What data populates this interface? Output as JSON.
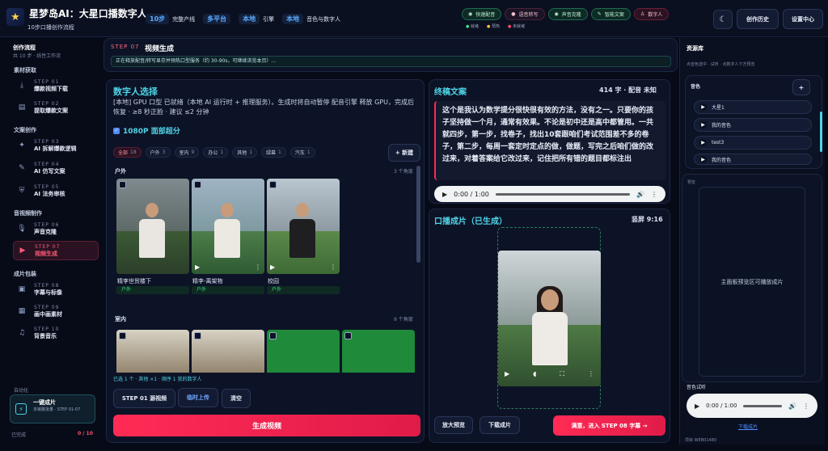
{
  "header": {
    "app_title": "星梦岛AI：大星口播数字人",
    "subtitle": "10步口播创作流程",
    "badges": [
      {
        "tag": "10步",
        "text": "完整产线"
      },
      {
        "tag": "多平台",
        "text": ""
      },
      {
        "tag": "本地",
        "text": "引擎"
      },
      {
        "tag": "本地",
        "text": "音色与数字人"
      }
    ],
    "services": [
      {
        "label": "快速配音",
        "color": "#3ddc84"
      },
      {
        "label": "语音转写",
        "color": "#ff4d6d"
      },
      {
        "label": "声音克隆",
        "color": "#3ddc84"
      },
      {
        "label": "智能文案",
        "color": "#3ddc84"
      },
      {
        "label": "数字人",
        "color": "#ff4d6d"
      }
    ],
    "legend": [
      {
        "label": "就绪",
        "color": "#3ddc84"
      },
      {
        "label": "预热",
        "color": "#ffb84d"
      },
      {
        "label": "未就绪",
        "color": "#ff4d6d"
      }
    ],
    "theme_icon": "moon-icon",
    "history_button": "创作历史",
    "settings_button": "设置中心"
  },
  "sidebar": {
    "title": "创作流程",
    "subtitle": "共 10 步 · 线性工作流",
    "groups": [
      {
        "label": "素材获取",
        "items": [
          {
            "step": "STEP 01",
            "name": "爆款视频下载",
            "icon": "download-icon"
          },
          {
            "step": "STEP 02",
            "name": "提取爆款文案",
            "icon": "document-icon"
          }
        ]
      },
      {
        "label": "文案创作",
        "items": [
          {
            "step": "STEP 03",
            "name": "AI 拆解爆款逻辑",
            "icon": "puzzle-icon"
          },
          {
            "step": "STEP 04",
            "name": "AI 仿写文案",
            "icon": "pen-icon"
          },
          {
            "step": "STEP 05",
            "name": "AI 法务审核",
            "icon": "shield-icon"
          }
        ]
      },
      {
        "label": "音视频制作",
        "items": [
          {
            "step": "STEP 06",
            "name": "声音克隆",
            "icon": "mic-icon"
          },
          {
            "step": "STEP 07",
            "name": "视频生成",
            "icon": "video-icon",
            "active": true
          }
        ]
      },
      {
        "label": "成片包装",
        "items": [
          {
            "step": "STEP 08",
            "name": "字幕与标像",
            "icon": "caption-icon"
          },
          {
            "step": "STEP 09",
            "name": "画中画素材",
            "icon": "picture-icon"
          },
          {
            "step": "STEP 10",
            "name": "背景音乐",
            "icon": "music-icon"
          }
        ]
      }
    ],
    "automation_label": "自动化",
    "oneclick_title": "一键成片",
    "oneclick_sub": "多链路批量 · STEP 01-07",
    "done_label": "已完成",
    "done_count": "0 / 10"
  },
  "step_bar": {
    "step": "STEP 07",
    "title": "视频生成",
    "notice": "正在释放配音/转写显存并预热口型服务（约 30-90s，可继续浏览本页）..."
  },
  "avatar_panel": {
    "title": "数字人选择",
    "status_text": "[本地] GPU 口型 已就绪（本地 AI 运行时 + 推理服务）。生成时将自动暂停 配音引擎 释放 GPU，完成后恢复 · ≥8 秒正脸 · 建议 ≤2 分钟",
    "hd_label": "1080P 面部超分",
    "filters": [
      {
        "label": "全部",
        "count": "18",
        "active": true
      },
      {
        "label": "户外",
        "count": "3"
      },
      {
        "label": "室内",
        "count": "9"
      },
      {
        "label": "办公",
        "count": "1"
      },
      {
        "label": "其他",
        "count": "1"
      },
      {
        "label": "绿幕",
        "count": "1"
      },
      {
        "label": "汽车",
        "count": "1"
      }
    ],
    "new_button": "+ 新建",
    "sections": [
      {
        "title": "户外",
        "count_text": "3 个角度",
        "cards": [
          {
            "name": "精李世贸楼下",
            "tag": "户外"
          },
          {
            "name": "精李-离架物",
            "tag": "户外"
          },
          {
            "name": "校园",
            "tag": "户外"
          }
        ]
      },
      {
        "title": "室内",
        "count_text": "9 个角度"
      }
    ],
    "selection_text": "已选 1 个 · 其他 ×1 · 顺序 1 我的数字人",
    "source_button": "STEP 01 源视频",
    "upload_button": "临时上传",
    "clear_button": "清空",
    "generate_button": "生成视频"
  },
  "script_panel": {
    "title": "终稿文案",
    "meta": "414 字 · 配音 未知",
    "text": "这个是我认为数学提分很快很有效的方法，没有之一。只要你的孩子坚持做一个月，通常有效果。不论是初中还是高中都管用。一共就四步，第一步，找卷子，找出10套跟咱们考试范围差不多的卷子，第二步，每周一套定时定点的做，做题，写完之后咱们做的改过来，对着答案给它改过来，记住把所有错的题目都标注出",
    "time": "0:00 / 1:00"
  },
  "video_panel": {
    "title": "口播成片（已生成）",
    "ratio": "竖屏 9:16",
    "preview_button": "放大预览",
    "download_button": "下载成片",
    "next_button": "满意，进入 STEP 08 字幕 →"
  },
  "resources": {
    "title": "资源库",
    "hint": "点音色选中 · 试听 · 点数字人下方预览",
    "voice_header": "音色",
    "voices": [
      "大星1",
      "我的音色",
      "test3",
      "我的音色"
    ],
    "preview_label": "预览",
    "preview_text": "主面板预览区可播放成片",
    "audition_label": "音色试听",
    "audition_time": "0:00 / 1:00",
    "download_link": "下载成片",
    "footer_label": "项目",
    "footer_value": "WEB01480"
  },
  "colors": {
    "accent": "#ff2b55",
    "ready": "#3ddc84",
    "title_cyan": "#4fd3e6"
  }
}
